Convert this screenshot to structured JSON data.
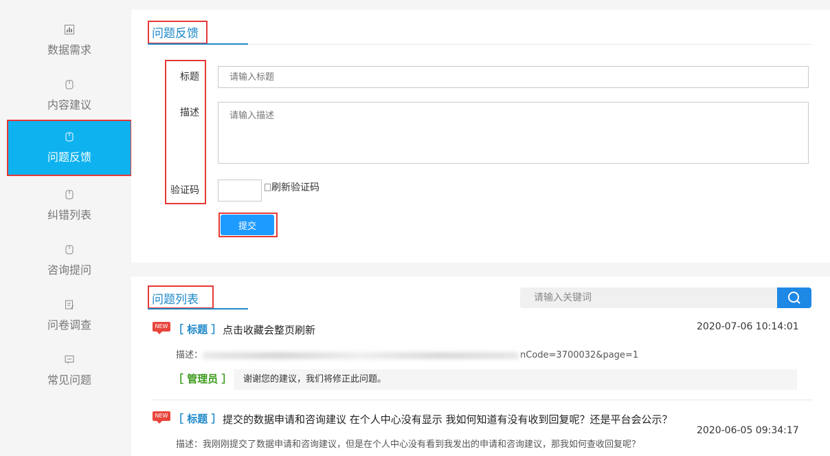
{
  "sidebar": {
    "items": [
      {
        "label": "数据需求",
        "icon": "bar-chart-icon"
      },
      {
        "label": "内容建议",
        "icon": "mouse-icon"
      },
      {
        "label": "问题反馈",
        "icon": "mouse-icon",
        "active": true
      },
      {
        "label": "纠错列表",
        "icon": "mouse-icon"
      },
      {
        "label": "咨询提问",
        "icon": "mouse-icon"
      },
      {
        "label": "问卷调查",
        "icon": "survey-icon"
      },
      {
        "label": "常见问题",
        "icon": "message-icon"
      }
    ]
  },
  "feedback_form": {
    "title": "问题反馈",
    "labels": {
      "title": "标题",
      "description": "描述",
      "captcha": "验证码"
    },
    "title_placeholder": "请输入标题",
    "description_placeholder": "请输入描述",
    "captcha_value": "",
    "captcha_image_alt": "刷新验证码",
    "submit_label": "提交"
  },
  "question_list": {
    "title": "问题列表",
    "search_placeholder": "请输入关键词",
    "items": [
      {
        "badge": "NEW",
        "tag": "［ 标题 ］",
        "title": "点击收藏会整页刷新",
        "time": "2020-07-06 10:14:01",
        "desc_label": "描述：",
        "desc_visible_tail": "nCode=3700032&page=1",
        "admin_tag": "［ 管理员 ］",
        "reply": "谢谢您的建议，我们将修正此问题。"
      },
      {
        "badge": "NEW",
        "tag": "［ 标题 ］",
        "title": "提交的数据申请和咨询建议 在个人中心没有显示 我如何知道有没有收到回复呢？还是平台会公示？",
        "time": "2020-06-05 09:34:17",
        "desc": "描述：我刚刚提交了数据申请和咨询建议，但是在个人中心没有看到我发出的申请和咨询建议，那我如何查收回复呢？"
      }
    ]
  },
  "colors": {
    "accent": "#0db2ef",
    "link_blue": "#1e88c9",
    "button_blue": "#1e9bff",
    "admin_green": "#3a9a1a",
    "highlight_red": "#e53935"
  }
}
